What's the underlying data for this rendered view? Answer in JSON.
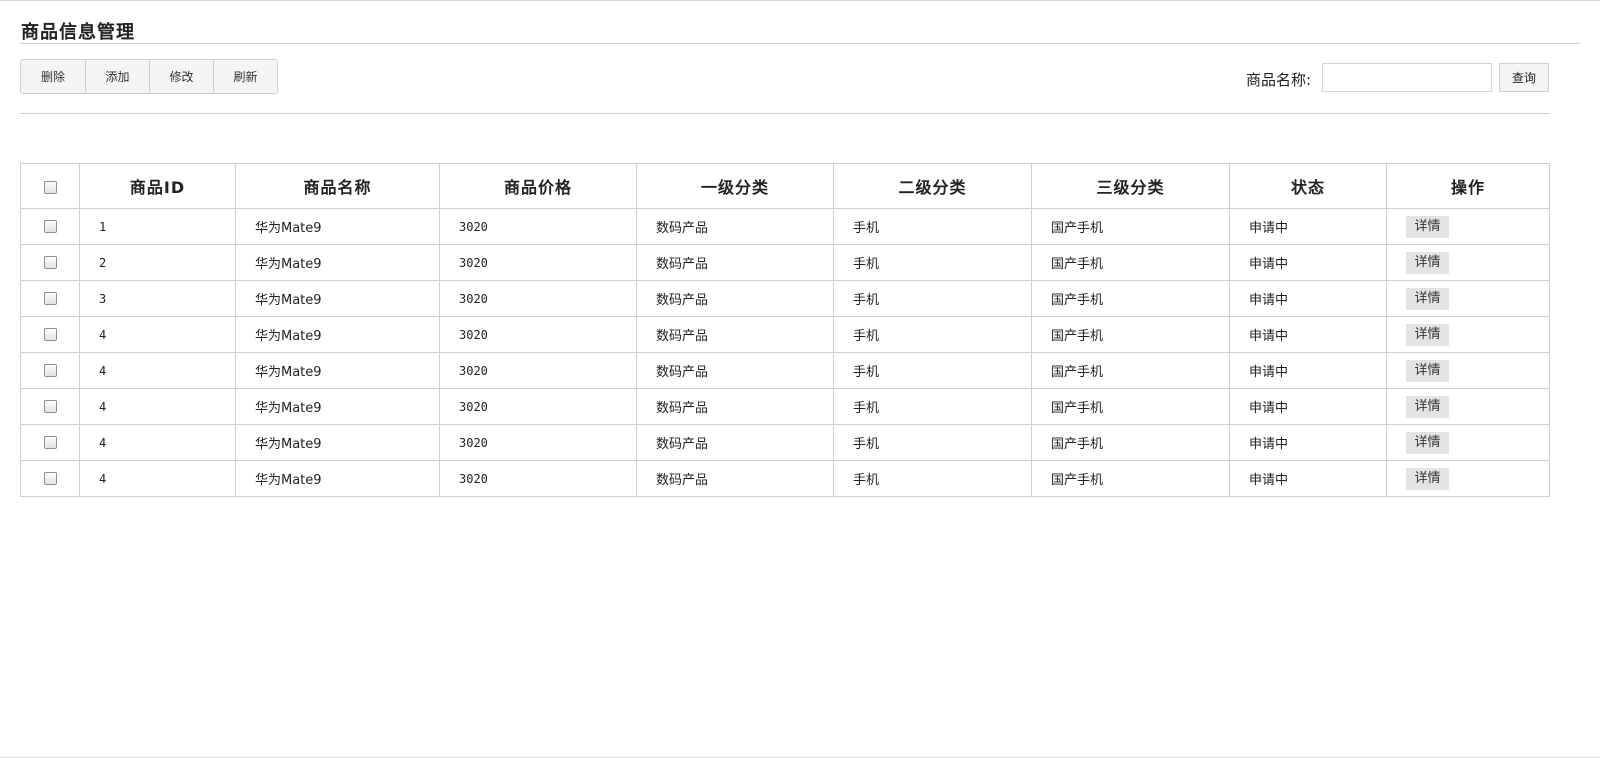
{
  "page": {
    "title": "商品信息管理"
  },
  "toolbar": {
    "buttons": [
      {
        "label": "删除"
      },
      {
        "label": "添加"
      },
      {
        "label": "修改"
      },
      {
        "label": "刷新"
      }
    ]
  },
  "search": {
    "label": "商品名称:",
    "value": "",
    "button": "查询"
  },
  "table": {
    "columns": [
      "商品ID",
      "商品名称",
      "商品价格",
      "一级分类",
      "二级分类",
      "三级分类",
      "状态",
      "操作"
    ],
    "rows": [
      {
        "id": "1",
        "name": "华为Mate9",
        "price": "3020",
        "cat1": "数码产品",
        "cat2": "手机",
        "cat3": "国产手机",
        "status": "申请中",
        "action": "详情"
      },
      {
        "id": "2",
        "name": "华为Mate9",
        "price": "3020",
        "cat1": "数码产品",
        "cat2": "手机",
        "cat3": "国产手机",
        "status": "申请中",
        "action": "详情"
      },
      {
        "id": "3",
        "name": "华为Mate9",
        "price": "3020",
        "cat1": "数码产品",
        "cat2": "手机",
        "cat3": "国产手机",
        "status": "申请中",
        "action": "详情"
      },
      {
        "id": "4",
        "name": "华为Mate9",
        "price": "3020",
        "cat1": "数码产品",
        "cat2": "手机",
        "cat3": "国产手机",
        "status": "申请中",
        "action": "详情"
      },
      {
        "id": "4",
        "name": "华为Mate9",
        "price": "3020",
        "cat1": "数码产品",
        "cat2": "手机",
        "cat3": "国产手机",
        "status": "申请中",
        "action": "详情"
      },
      {
        "id": "4",
        "name": "华为Mate9",
        "price": "3020",
        "cat1": "数码产品",
        "cat2": "手机",
        "cat3": "国产手机",
        "status": "申请中",
        "action": "详情"
      },
      {
        "id": "4",
        "name": "华为Mate9",
        "price": "3020",
        "cat1": "数码产品",
        "cat2": "手机",
        "cat3": "国产手机",
        "status": "申请中",
        "action": "详情"
      },
      {
        "id": "4",
        "name": "华为Mate9",
        "price": "3020",
        "cat1": "数码产品",
        "cat2": "手机",
        "cat3": "国产手机",
        "status": "申请中",
        "action": "详情"
      }
    ]
  }
}
